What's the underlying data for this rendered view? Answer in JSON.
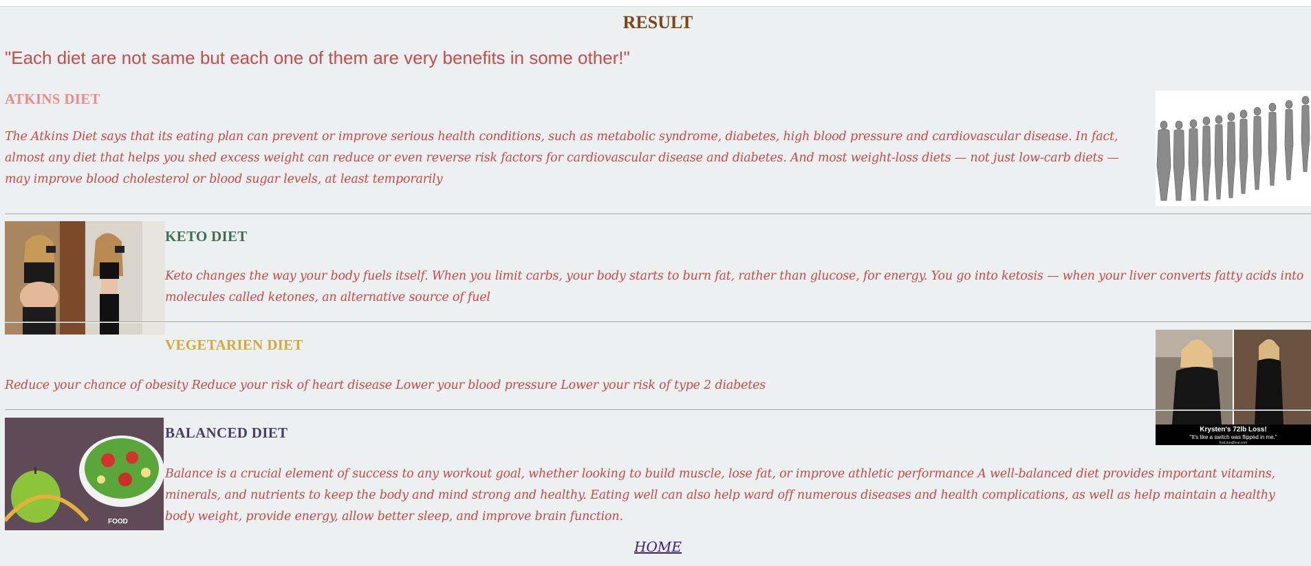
{
  "page": {
    "title": "RESULT",
    "quote": "\"Each diet are not same but each one of them are very benefits in some other!\""
  },
  "diets": {
    "atkins": {
      "title": "ATKINS DIET",
      "text": "The Atkins Diet says that its eating plan can prevent or improve serious health conditions, such as metabolic syndrome, diabetes, high blood pressure and cardiovascular disease. In fact, almost any diet that helps you shed excess weight can reduce or even reverse risk factors for cardiovascular disease and diabetes. And most weight-loss diets — not just low-carb diets — may improve blood cholesterol or blood sugar levels, at least temporarily"
    },
    "keto": {
      "title": "KETO DIET",
      "text": "Keto changes the way your body fuels itself. When you limit carbs, your body starts to burn fat, rather than glucose, for energy. You go into ketosis — when your liver converts fatty acids into molecules called ketones, an alternative source of fuel"
    },
    "vegetarien": {
      "title": "VEGETARIEN DIET",
      "text": "Reduce your chance of obesity Reduce your risk of heart disease Lower your blood pressure Lower your risk of type 2 diabetes",
      "image_caption_line1": "Krysten's 72lb Loss!",
      "image_caption_line2": "\"It's like a switch was flipped in me.\"",
      "image_caption_line3": "EatLikeaBear.com"
    },
    "balanced": {
      "title": "BALANCED DIET",
      "text": "Balance is a crucial element of success to any workout goal, whether looking to build muscle, lose fat, or improve athletic performance A well-balanced diet provides important vitamins, minerals, and nutrients to keep the body and mind strong and healthy. Eating well can also help ward off numerous diseases and health complications, as well as help maintain a healthy body weight, provide energy, allow better sleep, and improve brain function.",
      "image_badge": "FOOD"
    }
  },
  "footer": {
    "home_label": "HOME"
  },
  "colors": {
    "background": "#ecf0f1",
    "result_title": "#7a4517",
    "quote": "#c94b4b",
    "atkins_title": "#f08a8a",
    "keto_title": "#3e6e55",
    "vegetarien_title": "#d4a935",
    "balanced_title": "#4a3c66",
    "body_text": "#c54a4a",
    "home_link": "#3b1c7a"
  }
}
